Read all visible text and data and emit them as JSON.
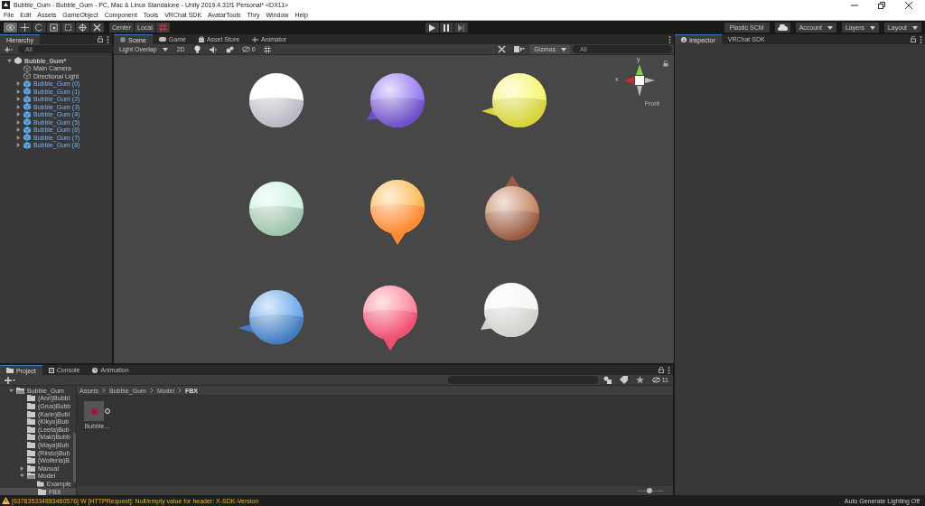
{
  "window": {
    "title": "Bubble_Gum - Bubble_Gum - PC, Mac & Linux Standalone - Unity 2019.4.31f1 Personal* <DX11>"
  },
  "menu": [
    "File",
    "Edit",
    "Assets",
    "GameObject",
    "Component",
    "Tools",
    "VRChat SDK",
    "AvatarTools",
    "Thry",
    "Window",
    "Help"
  ],
  "toolbar": {
    "tools": [
      {
        "kind": "eye",
        "selected": true
      },
      {
        "kind": "move",
        "selected": false
      },
      {
        "kind": "rotate",
        "selected": false
      },
      {
        "kind": "scale",
        "selected": false
      },
      {
        "kind": "rect",
        "selected": false
      },
      {
        "kind": "transform",
        "selected": false
      },
      {
        "kind": "custom",
        "selected": false
      }
    ],
    "pivot": [
      "Center",
      "Local"
    ],
    "right": [
      {
        "kind": "plain",
        "label": "Plastic SCM"
      },
      {
        "kind": "cloud"
      },
      {
        "kind": "dropdown",
        "label": "Account"
      },
      {
        "kind": "dropdown",
        "label": "Layers"
      },
      {
        "kind": "dropdown",
        "label": "Layout"
      }
    ]
  },
  "hierarchy": {
    "tabs": [
      {
        "label": "Hierarchy",
        "selected": true
      }
    ],
    "search": {
      "placeholder": "All"
    },
    "tree": [
      {
        "label": "Bubble_Gum*",
        "kind": "scene",
        "expanded": true,
        "children": [
          {
            "label": "Main Camera",
            "kind": "object"
          },
          {
            "label": "Directional Light",
            "kind": "object"
          },
          {
            "label": "Bubble_Gum (0)",
            "kind": "prefab",
            "expanded": false
          },
          {
            "label": "Bubble_Gum (1)",
            "kind": "prefab",
            "expanded": false
          },
          {
            "label": "Bubble_Gum (2)",
            "kind": "prefab",
            "expanded": false
          },
          {
            "label": "Bubble_Gum (3)",
            "kind": "prefab",
            "expanded": false
          },
          {
            "label": "Bubble_Gum (4)",
            "kind": "prefab",
            "expanded": false
          },
          {
            "label": "Bubble_Gum (5)",
            "kind": "prefab",
            "expanded": false
          },
          {
            "label": "Bubble_Gum (6)",
            "kind": "prefab",
            "expanded": false
          },
          {
            "label": "Bubble_Gum (7)",
            "kind": "prefab",
            "expanded": false
          },
          {
            "label": "Bubble_Gum (8)",
            "kind": "prefab",
            "expanded": false
          }
        ]
      }
    ]
  },
  "scene": {
    "tabs": [
      {
        "label": "Scene",
        "kind": "scene",
        "selected": true
      },
      {
        "label": "Game",
        "kind": "game",
        "selected": false
      },
      {
        "label": "Asset Store",
        "kind": "store",
        "selected": false
      },
      {
        "label": "Animator",
        "kind": "animator",
        "selected": false
      }
    ],
    "draw_mode": "Light Overlap",
    "mode_2d": {
      "label": "2D",
      "on": false
    },
    "hidden_count": "0",
    "gizmos": "Gizmos",
    "search": {
      "placeholder": "All"
    },
    "gizmo": {
      "y": "y",
      "x": "x",
      "view": "Front"
    }
  },
  "inspector": {
    "tabs": [
      {
        "label": "Inspector",
        "selected": true
      },
      {
        "label": "VRChat SDK",
        "selected": false
      }
    ]
  },
  "project": {
    "tabs": [
      {
        "label": "Project",
        "kind": "project",
        "selected": true
      },
      {
        "label": "Console",
        "kind": "console",
        "selected": false
      },
      {
        "label": "Animation",
        "kind": "animation",
        "selected": false
      }
    ],
    "tree": [
      {
        "label": "Bubble_Gum",
        "expanded": true,
        "selected": false,
        "children": [
          {
            "label": "(Anri)Bubbl",
            "selected": false
          },
          {
            "label": "(Grus)Bubb",
            "selected": false
          },
          {
            "label": "(Karin)Bubl",
            "selected": false
          },
          {
            "label": "(Kikyo)Bub",
            "selected": false
          },
          {
            "label": "(Leefa)Bub",
            "selected": false
          },
          {
            "label": "(Maki)Bubb",
            "selected": false
          },
          {
            "label": "(Maya)Bub",
            "selected": false
          },
          {
            "label": "(Rindo)Bub",
            "selected": false
          },
          {
            "label": "(Wolferia)B",
            "selected": false
          },
          {
            "label": "Manual",
            "expanded": false,
            "selected": false
          },
          {
            "label": "Model",
            "expanded": true,
            "selected": false,
            "children": [
              {
                "label": "Example",
                "selected": false
              },
              {
                "label": "FBX",
                "selected": true
              }
            ]
          }
        ]
      }
    ],
    "breadcrumb": [
      "Assets",
      "Bubble_Gum",
      "Model",
      "FBX"
    ],
    "hidden_count": "11",
    "assets": [
      {
        "label": "Bubble..."
      }
    ],
    "zoom": {
      "level": 0.45
    }
  },
  "status": {
    "message": "[637835334883460576] W [HTTPRequest]: Null/empty value for header: X-SDK-Version",
    "lighting": "Auto Generate Lighting Off"
  }
}
